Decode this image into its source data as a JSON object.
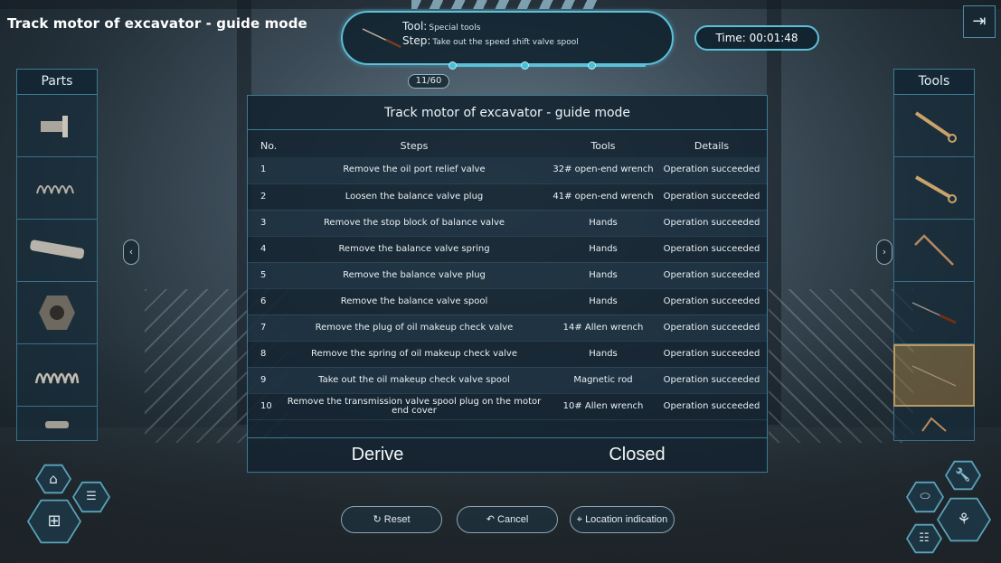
{
  "app_title": "Track motor of excavator - guide mode",
  "step_panel": {
    "tool_key": "Tool:",
    "tool_value": "Special tools",
    "step_key": "Step:",
    "step_value": "Take out the speed shift valve spool",
    "counter": "11/60"
  },
  "timer": "Time:  00:01:48",
  "parts_panel": {
    "title": "Parts"
  },
  "tools_panel": {
    "title": "Tools"
  },
  "modal": {
    "title": "Track motor of excavator - guide mode",
    "headers": {
      "no": "No.",
      "steps": "Steps",
      "tools": "Tools",
      "details": "Details"
    },
    "rows": [
      {
        "no": "1",
        "step": "Remove the oil port relief valve",
        "tool": "32# open-end wrench",
        "detail": "Operation succeeded"
      },
      {
        "no": "2",
        "step": "Loosen the balance valve plug",
        "tool": "41# open-end wrench",
        "detail": "Operation succeeded"
      },
      {
        "no": "3",
        "step": "Remove the stop block of balance valve",
        "tool": "Hands",
        "detail": "Operation succeeded"
      },
      {
        "no": "4",
        "step": "Remove the balance valve spring",
        "tool": "Hands",
        "detail": "Operation succeeded"
      },
      {
        "no": "5",
        "step": "Remove the balance valve plug",
        "tool": "Hands",
        "detail": "Operation succeeded"
      },
      {
        "no": "6",
        "step": "Remove the balance valve spool",
        "tool": "Hands",
        "detail": "Operation succeeded"
      },
      {
        "no": "7",
        "step": "Remove the plug of oil makeup check valve",
        "tool": "14# Allen wrench",
        "detail": "Operation succeeded"
      },
      {
        "no": "8",
        "step": "Remove the spring of oil makeup check valve",
        "tool": "Hands",
        "detail": "Operation succeeded"
      },
      {
        "no": "9",
        "step": "Take out the oil makeup check valve spool",
        "tool": "Magnetic rod",
        "detail": "Operation succeeded"
      },
      {
        "no": "10",
        "step": "Remove the transmission valve spool plug on the motor end cover",
        "tool": "10# Allen wrench",
        "detail": "Operation succeeded"
      }
    ],
    "derive_label": "Derive",
    "closed_label": "Closed"
  },
  "bottom_buttons": {
    "reset": "Reset",
    "cancel": "Cancel",
    "location": "Location indication"
  },
  "colors": {
    "accent": "#5cc0d6",
    "panel": "#142430",
    "selected_slot": "#967846"
  }
}
